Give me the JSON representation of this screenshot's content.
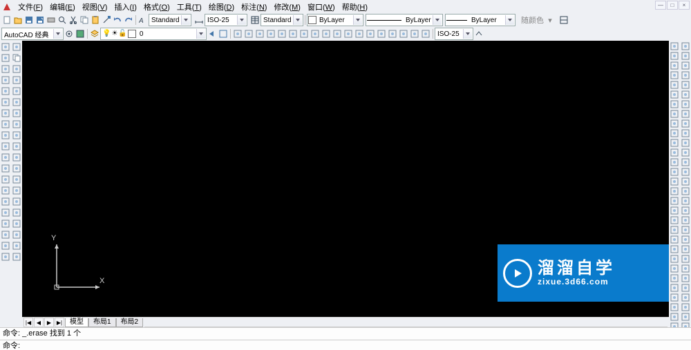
{
  "window_controls": {
    "min": "—",
    "max": "□",
    "close": "×"
  },
  "menu": [
    {
      "label": "文件",
      "hot": "F"
    },
    {
      "label": "编辑",
      "hot": "E"
    },
    {
      "label": "视图",
      "hot": "V"
    },
    {
      "label": "插入",
      "hot": "I"
    },
    {
      "label": "格式",
      "hot": "O"
    },
    {
      "label": "工具",
      "hot": "T"
    },
    {
      "label": "绘图",
      "hot": "D"
    },
    {
      "label": "标注",
      "hot": "N"
    },
    {
      "label": "修改",
      "hot": "M"
    },
    {
      "label": "窗口",
      "hot": "W"
    },
    {
      "label": "帮助",
      "hot": "H"
    }
  ],
  "row2": {
    "std_icons": [
      "new",
      "open",
      "save",
      "save-as",
      "plot",
      "preview",
      "cut",
      "copy",
      "paste",
      "match",
      "undo",
      "redo"
    ],
    "text_style": "Standard",
    "dim_style": "ISO-25",
    "table_style": "Standard",
    "layer_color": "ByLayer",
    "linetype": "ByLayer",
    "lineweight": "ByLayer",
    "bycolor_label": "随颜色"
  },
  "row3": {
    "workspace": "AutoCAD 经典",
    "layer": "0",
    "layer_state_icons": [
      "on",
      "freeze",
      "lock",
      "color"
    ],
    "snap_icons": [
      "linear",
      "angular",
      "arc",
      "aligned",
      "radius",
      "diameter",
      "jogged",
      "ordinate",
      "quick",
      "baseline",
      "continue",
      "tol",
      "center",
      "leader",
      "text",
      "edit",
      "update",
      "dimstyle"
    ],
    "dim_combo": "ISO-25"
  },
  "left_draw": [
    "line",
    "xline",
    "pline",
    "polygon",
    "rectangle",
    "arc",
    "circle",
    "revcloud",
    "spline",
    "ellipse",
    "ellipse-arc",
    "insert",
    "block",
    "point",
    "hatch",
    "gradient",
    "region",
    "table",
    "mtext",
    "addpoint"
  ],
  "left_modify": [
    "erase",
    "copy",
    "mirror",
    "offset",
    "array",
    "move",
    "rotate",
    "scale",
    "stretch",
    "trim",
    "extend",
    "break-pt",
    "break",
    "join",
    "chamfer",
    "fillet",
    "explode",
    "editpl",
    "editha",
    "edittxt"
  ],
  "right_a": [
    "dist",
    "area",
    "region-mass",
    "list",
    "id",
    "tracking",
    "from",
    "endpoint",
    "midpoint",
    "intersect",
    "apparent",
    "ext",
    "center",
    "quadrant",
    "tangent",
    "perp",
    "parallel",
    "node",
    "insert",
    "nearest",
    "none",
    "osnap",
    "temp1",
    "temp2",
    "temp3",
    "temp4",
    "temp5",
    "temp6",
    "temp7",
    "temp8",
    "temp9"
  ],
  "right_b": [
    "dim-lin",
    "dim-align",
    "dim-arc",
    "dim-ord",
    "dim-rad",
    "dim-jog",
    "dim-dia",
    "dim-ang",
    "dim-quick",
    "dim-base",
    "dim-cont",
    "dim-space",
    "dim-break",
    "dim-tol",
    "dim-center",
    "dim-insp",
    "dim-jogln",
    "dim-edit",
    "dim-tedit",
    "dim-update",
    "dim-style",
    "dim-override",
    "dim2-a",
    "dim2-b",
    "dim2-c",
    "dim2-d",
    "dim2-e",
    "dim2-f",
    "dim2-g",
    "dim2-h",
    "dim2-i"
  ],
  "ucs": {
    "y": "Y",
    "x": "X"
  },
  "tabs": {
    "nav": [
      "|◀",
      "◀",
      "▶",
      "▶|"
    ],
    "model": "模型",
    "layouts": [
      "布局1",
      "布局2"
    ]
  },
  "cmd_history": "命令: _.erase 找到 1 个",
  "cmd_prompt": "命令:",
  "watermark": {
    "cn": "溜溜自学",
    "en": "zixue.3d66.com"
  }
}
